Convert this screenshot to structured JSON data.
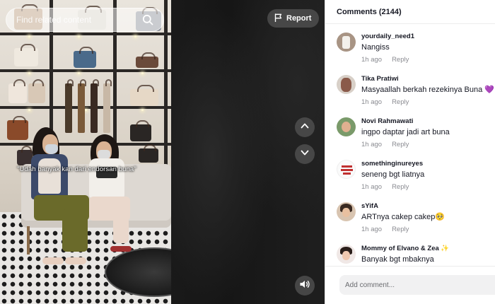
{
  "search": {
    "placeholder": "Find related content"
  },
  "video": {
    "caption": "\"Udah banyak kan dari endorsan buna\"",
    "report_label": "Report"
  },
  "icons": {
    "search": "search-icon",
    "report": "flag-icon",
    "prev": "chevron-up-icon",
    "next": "chevron-down-icon",
    "sound": "volume-icon"
  },
  "comments_panel": {
    "title": "Comments (2144)",
    "add_placeholder": "Add comment...",
    "items": [
      {
        "user": "yourdaily_need1",
        "text": "Nangiss",
        "time": "1h ago",
        "reply": "Reply"
      },
      {
        "user": "Tika Pratiwi",
        "text": "Masyaallah berkah rezekinya Buna 💜",
        "time": "1h ago",
        "reply": "Reply"
      },
      {
        "user": "Novi Rahmawati",
        "text": "ingpo daptar jadi art buna",
        "time": "1h ago",
        "reply": "Reply"
      },
      {
        "user": "somethinginureyes",
        "text": "seneng bgt liatnya",
        "time": "1h ago",
        "reply": "Reply"
      },
      {
        "user": "sYifA",
        "text": "ARTnya cakep cakep🥺",
        "time": "1h ago",
        "reply": "Reply"
      },
      {
        "user": "Mommy of Elvano & Zea ✨",
        "text": "Banyak bgt mbaknya",
        "time": "",
        "reply": ""
      }
    ]
  },
  "colors": {
    "panel_bg": "#ffffff",
    "text_primary": "#161823",
    "text_secondary": "#8a8b91",
    "overlay_button": "#545454"
  }
}
